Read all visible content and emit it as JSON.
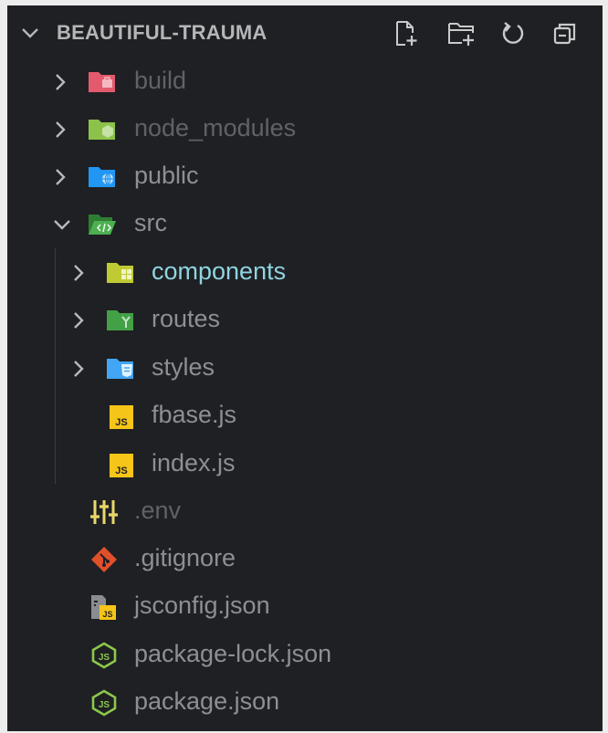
{
  "explorer": {
    "title": "BEAUTIFUL-TRAUMA",
    "actions": [
      {
        "name": "new-file-icon"
      },
      {
        "name": "new-folder-icon"
      },
      {
        "name": "refresh-icon"
      },
      {
        "name": "collapse-all-icon"
      }
    ]
  },
  "tree": {
    "build": "build",
    "node_modules": "node_modules",
    "public": "public",
    "src": "src",
    "components": "components",
    "routes": "routes",
    "styles": "styles",
    "fbase": "fbase.js",
    "index": "index.js",
    "env": ".env",
    "gitignore": ".gitignore",
    "jsconfig": "jsconfig.json",
    "package_lock": "package-lock.json",
    "package": "package.json"
  },
  "colors": {
    "background": "#1f2023",
    "selected_text": "#8fd4e0",
    "build_folder": "#e35a6d",
    "node_folder": "#8bc34a",
    "public_folder": "#2196f3",
    "src_folder": "#4caf50",
    "components_folder": "#c0ca33",
    "routes_folder": "#43a047",
    "styles_folder": "#42a5f5",
    "js_icon": "#f5c518",
    "git_icon": "#e2502b",
    "node_icon": "#8cc84b"
  }
}
